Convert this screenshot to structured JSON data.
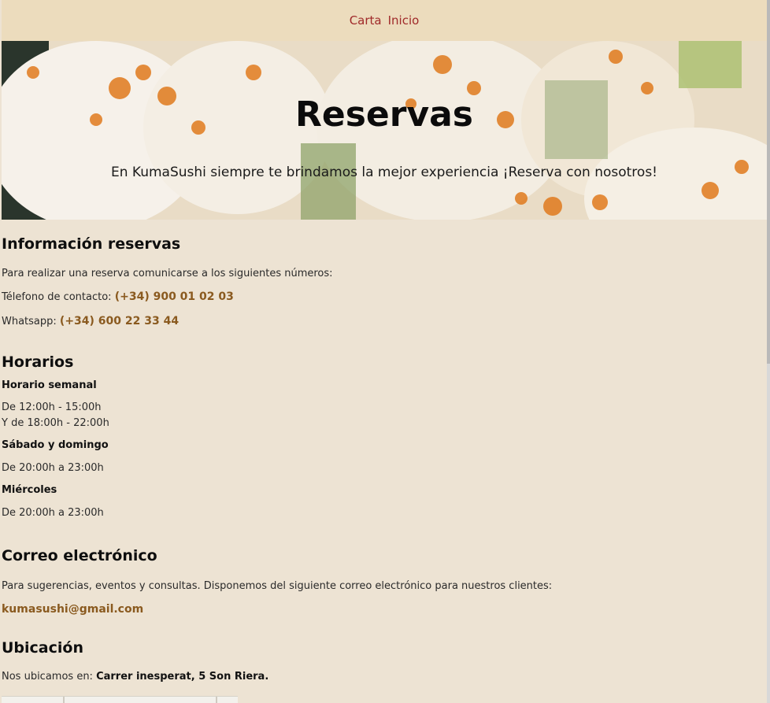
{
  "nav": {
    "items": [
      "Carta",
      "Inicio"
    ]
  },
  "hero": {
    "title": "Reservas",
    "subtitle": "En KumaSushi siempre te brindamos la mejor experiencia ¡Reserva con nosotros!"
  },
  "reservas": {
    "heading": "Información reservas",
    "intro": "Para realizar una reserva comunicarse a los siguientes números:",
    "phone_label": "Télefono de contacto: ",
    "phone_value": "(+34) 900 01 02 03",
    "whatsapp_label": "Whatsapp: ",
    "whatsapp_value": "(+34) 600 22 33 44"
  },
  "horarios": {
    "heading": "Horarios",
    "weekly_title": "Horario semanal",
    "weekly_line1": "De 12:00h - 15:00h",
    "weekly_line2": "Y de 18:00h - 22:00h",
    "weekend_title": "Sábado y domingo",
    "weekend_line": "De 20:00h a 23:00h",
    "wednesday_title": "Miércoles",
    "wednesday_line": "De 20:00h a 23:00h"
  },
  "correo": {
    "heading": "Correo electrónico",
    "intro": "Para sugerencias, eventos y consultas. Disponemos del siguiente correo electrónico para nuestros clientes:",
    "email": "kumasushi@gmail.com"
  },
  "ubicacion": {
    "heading": "Ubicación",
    "label": "Nos ubicamos en: ",
    "address": "Carrer inesperat, 5 Son Riera."
  },
  "colors": {
    "background": "#ede3d3",
    "navbar": "#ecdcbd",
    "nav_link": "#a02a2a",
    "highlight": "#8a5a1f"
  }
}
